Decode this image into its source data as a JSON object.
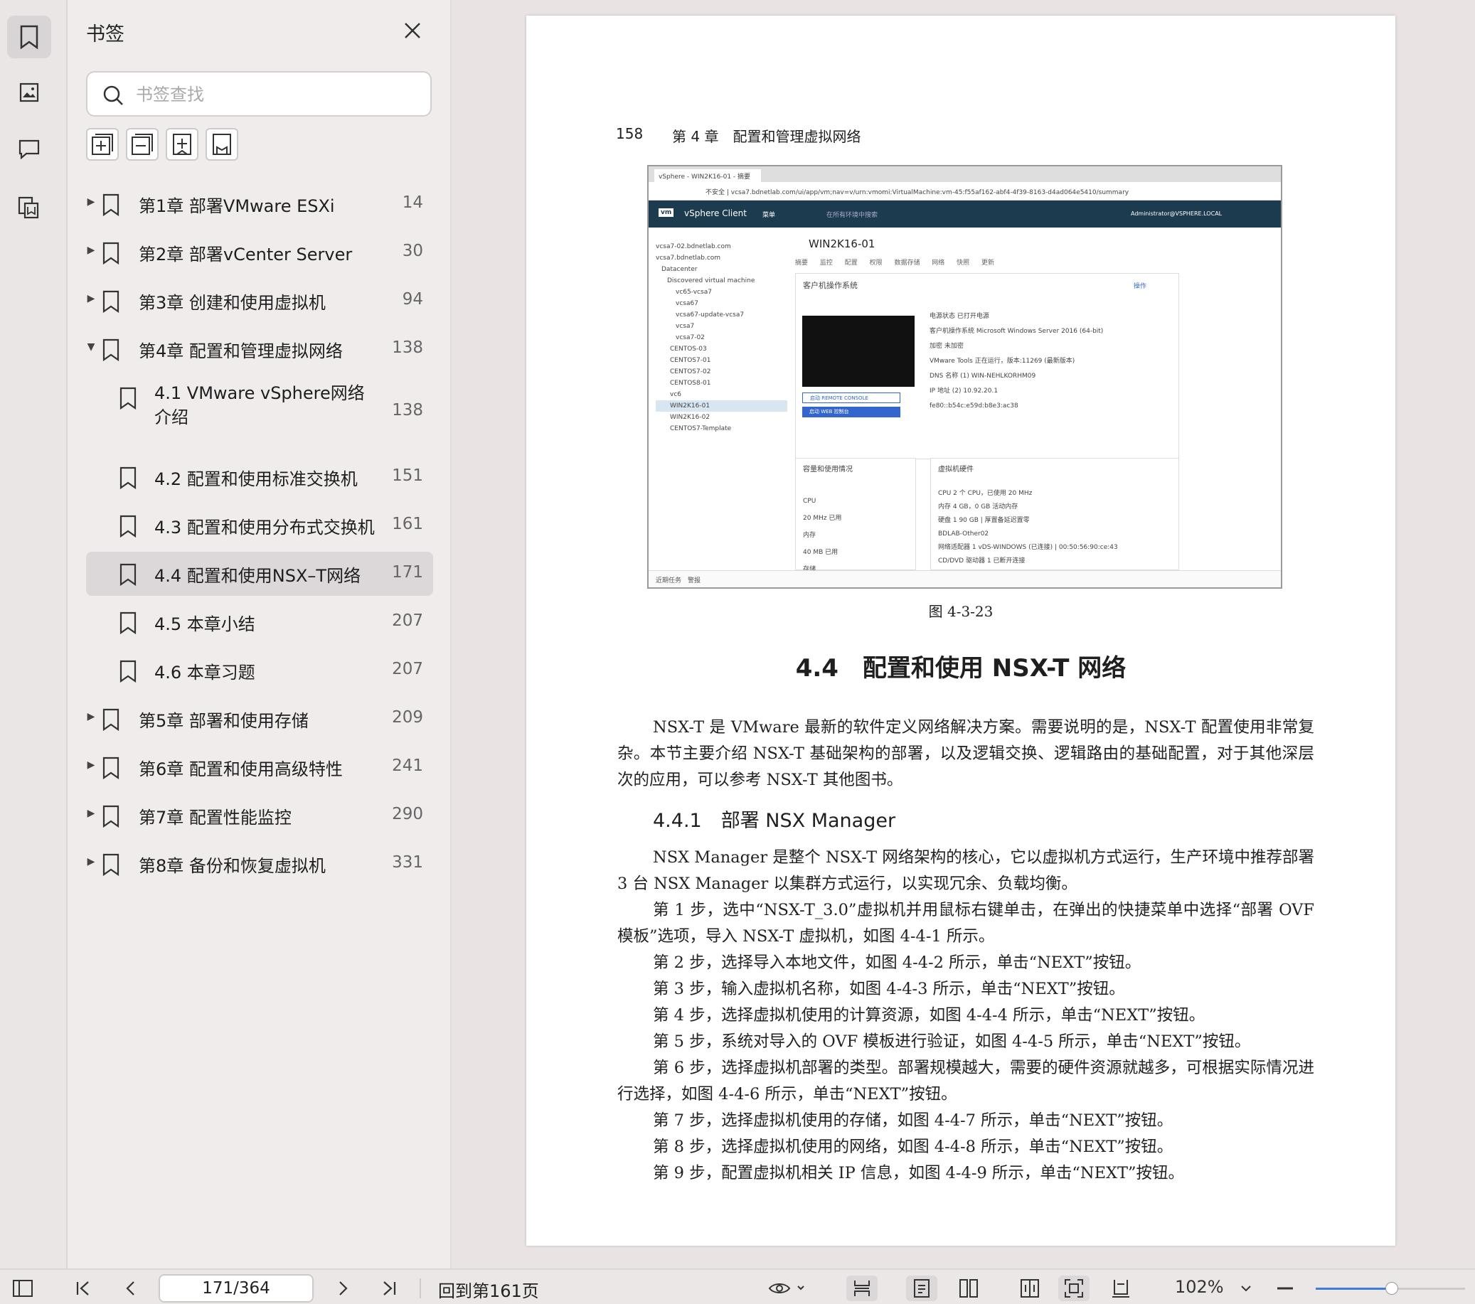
{
  "panel": {
    "title": "书签",
    "search_placeholder": "书签查找"
  },
  "bookmarks": [
    {
      "label": "第1章 部署VMware ESXi",
      "page": "14",
      "level": 0,
      "expanded": false
    },
    {
      "label": "第2章 部署vCenter Server",
      "page": "30",
      "level": 0,
      "expanded": false
    },
    {
      "label": "第3章 创建和使用虚拟机",
      "page": "94",
      "level": 0,
      "expanded": false
    },
    {
      "label": "第4章 配置和管理虚拟网络",
      "page": "138",
      "level": 0,
      "expanded": true
    },
    {
      "label": "4.1 VMware vSphere网络介绍",
      "page": "138",
      "level": 1
    },
    {
      "label": "4.2 配置和使用标准交换机",
      "page": "151",
      "level": 1
    },
    {
      "label": "4.3 配置和使用分布式交换机",
      "page": "161",
      "level": 1
    },
    {
      "label": "4.4 配置和使用NSX–T网络",
      "page": "171",
      "level": 1,
      "selected": true
    },
    {
      "label": "4.5 本章小结",
      "page": "207",
      "level": 1
    },
    {
      "label": "4.6 本章习题",
      "page": "207",
      "level": 1
    },
    {
      "label": "第5章 部署和使用存储",
      "page": "209",
      "level": 0,
      "expanded": false
    },
    {
      "label": "第6章 配置和使用高级特性",
      "page": "241",
      "level": 0,
      "expanded": false
    },
    {
      "label": "第7章 配置性能监控",
      "page": "290",
      "level": 0,
      "expanded": false
    },
    {
      "label": "第8章 备份和恢复虚拟机",
      "page": "331",
      "level": 0,
      "expanded": false
    }
  ],
  "doc": {
    "page_number": "158",
    "chapter_header": "第 4 章　配置和管理虚拟网络",
    "figure_caption": "图 4-3-23",
    "section_title": "4.4　配置和使用 NSX-T 网络",
    "intro": "NSX-T 是 VMware 最新的软件定义网络解决方案。需要说明的是，NSX-T 配置使用非常复杂。本节主要介绍 NSX-T 基础架构的部署，以及逻辑交换、逻辑路由的基础配置，对于其他深层次的应用，可以参考 NSX-T 其他图书。",
    "subsection_title": "4.4.1　部署 NSX Manager",
    "paragraphs": [
      "NSX Manager 是整个 NSX-T 网络架构的核心，它以虚拟机方式运行，生产环境中推荐部署 3 台 NSX Manager 以集群方式运行，以实现冗余、负载均衡。",
      "第 1 步，选中“NSX-T_3.0”虚拟机并用鼠标右键单击，在弹出的快捷菜单中选择“部署 OVF 模板”选项，导入 NSX-T 虚拟机，如图 4-4-1 所示。",
      "第 2 步，选择导入本地文件，如图 4-4-2 所示，单击“NEXT”按钮。",
      "第 3 步，输入虚拟机名称，如图 4-4-3 所示，单击“NEXT”按钮。",
      "第 4 步，选择虚拟机使用的计算资源，如图 4-4-4 所示，单击“NEXT”按钮。",
      "第 5 步，系统对导入的 OVF 模板进行验证，如图 4-4-5 所示，单击“NEXT”按钮。",
      "第 6 步，选择虚拟机部署的类型。部署规模越大，需要的硬件资源就越多，可根据实际情况进行选择，如图 4-4-6 所示，单击“NEXT”按钮。",
      "第 7 步，选择虚拟机使用的存储，如图 4-4-7 所示，单击“NEXT”按钮。",
      "第 8 步，选择虚拟机使用的网络，如图 4-4-8 所示，单击“NEXT”按钮。",
      "第 9 步，配置虚拟机相关 IP 信息，如图 4-4-9 所示，单击“NEXT”按钮。"
    ]
  },
  "shot": {
    "tab": "vSphere - WIN2K16-01 - 摘要",
    "address": "不安全 | vcsa7.bdnetlab.com/ui/app/vm;nav=v/urn:vmomi:VirtualMachine:vm-45:f55af162-abf4-4f39-8163-d4ad064e5410/summary",
    "app_name": "vSphere Client",
    "menu": "菜单",
    "search": "在所有环境中搜索",
    "user": "Administrator@VSPHERE.LOCAL",
    "tree": [
      "vcsa7-02.bdnetlab.com",
      "vcsa7.bdnetlab.com",
      "Datacenter",
      "Discovered virtual machine",
      "vc65-vcsa7",
      "vcsa67",
      "vcsa67-update-vcsa7",
      "vcsa7",
      "vcsa7-02",
      "CENTOS-03",
      "CENTOS7-01",
      "CENTOS7-02",
      "CENTOS8-01",
      "vc6",
      "WIN2K16-01",
      "WIN2K16-02",
      "CENTOS7-Template"
    ],
    "vm_name": "WIN2K16-01",
    "subtabs": "摘要 监控 配置 权限 数据存储 网络 快照 更新",
    "card_guest": "客户机操作系统",
    "actions": "操作",
    "btn_remote": "启动 REMOTE CONSOLE",
    "btn_web": "启动 WEB 控制台",
    "info": [
      "电源状态 已打开电源",
      "客户机操作系统 Microsoft Windows Server 2016 (64-bit)",
      "加密 未加密",
      "VMware Tools 正在运行，版本:11269 (最新版本)",
      "DNS 名称 (1) WIN-NEHLKORHM09",
      "IP 地址 (2) 10.92.20.1",
      "fe80::b54c:e59d:b8e3:ac38"
    ],
    "card_capacity": "容量和使用情况",
    "cap_lines": [
      "CPU",
      "20 MHz 已用",
      "内存",
      "40 MB 已用",
      "存储"
    ],
    "card_hw": "虚拟机硬件",
    "hw_lines": [
      "CPU 2 个 CPU，已使用 20 MHz",
      "内存 4 GB，0 GB 活动内存",
      "硬盘 1 90 GB | 厚置备延迟置零",
      "BDLAB-Other02",
      "网络适配器 1 vDS-WINDOWS (已连接) | 00:50:56:90:ce:43",
      "CD/DVD 驱动器 1 已断开连接"
    ],
    "footer": "近期任务　警报"
  },
  "bottom": {
    "page_input": "171/364",
    "goto_label": "回到第161页",
    "zoom": "102%",
    "zoom_fraction": 0.51
  }
}
